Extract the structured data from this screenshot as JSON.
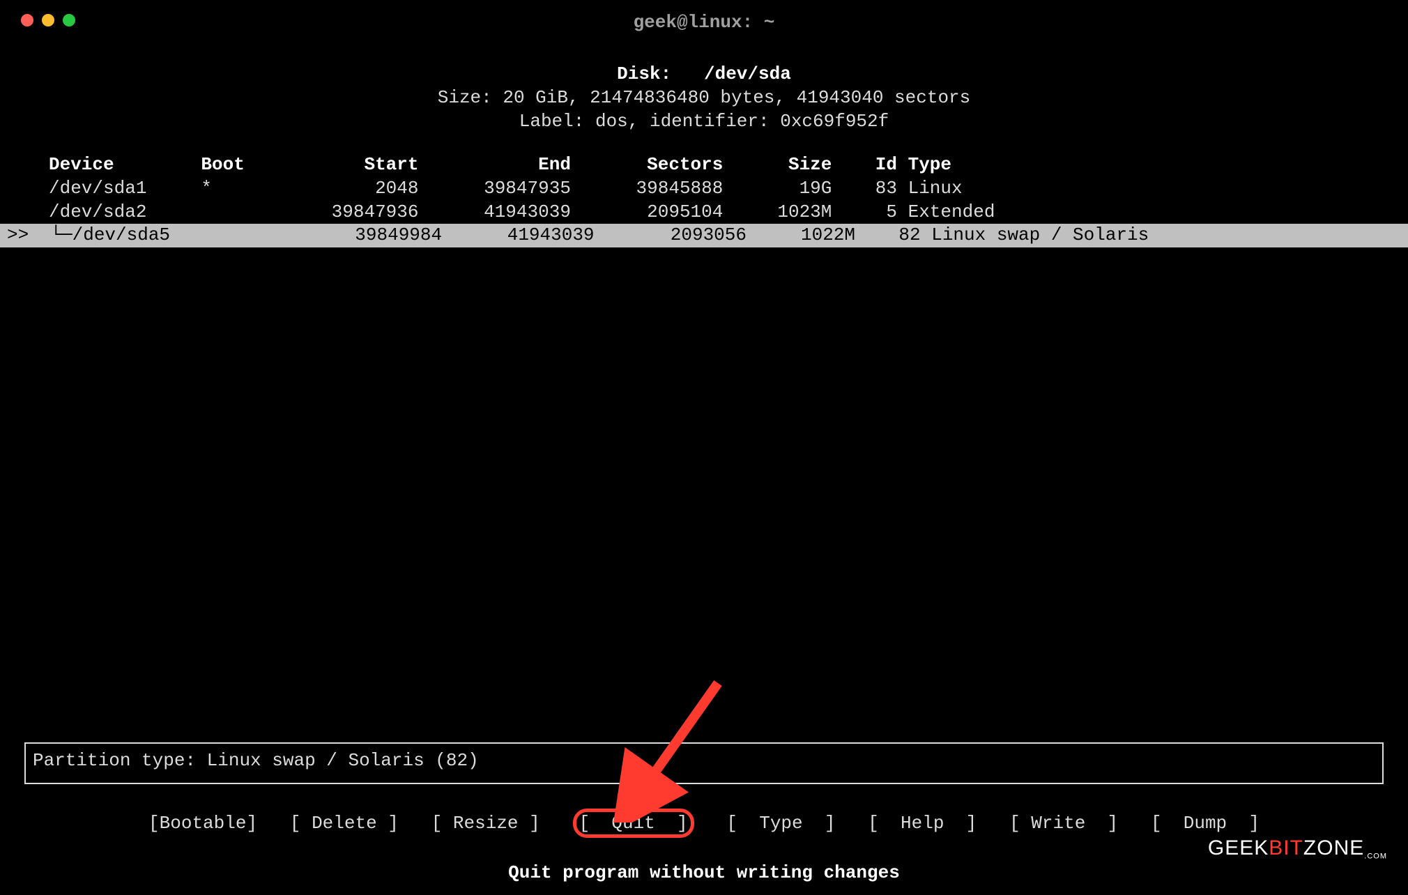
{
  "window": {
    "title": "geek@linux: ~"
  },
  "header": {
    "disk_label": "Disk:",
    "disk_path": "/dev/sda",
    "size_line": "Size: 20 GiB, 21474836480 bytes, 41943040 sectors",
    "label_line": "Label: dos, identifier: 0xc69f952f"
  },
  "table": {
    "columns": {
      "device": "Device",
      "boot": "Boot",
      "start": "Start",
      "end": "End",
      "sectors": "Sectors",
      "size": "Size",
      "id": "Id",
      "type": "Type"
    },
    "rows": [
      {
        "selected": false,
        "prefix": "",
        "device": "/dev/sda1",
        "boot": "*",
        "start": "2048",
        "end": "39847935",
        "sectors": "39845888",
        "size": "19G",
        "id": "83",
        "type": "Linux"
      },
      {
        "selected": false,
        "prefix": "",
        "device": "/dev/sda2",
        "boot": "",
        "start": "39847936",
        "end": "41943039",
        "sectors": "2095104",
        "size": "1023M",
        "id": "5",
        "type": "Extended"
      },
      {
        "selected": true,
        "prefix": ">>  └─",
        "device": "/dev/sda5",
        "boot": "",
        "start": "39849984",
        "end": "41943039",
        "sectors": "2093056",
        "size": "1022M",
        "id": "82",
        "type": "Linux swap / Solaris"
      }
    ]
  },
  "partition_info": "Partition type: Linux swap / Solaris (82)",
  "menu": {
    "items": [
      {
        "label": "Bootable",
        "highlighted": false
      },
      {
        "label": "Delete",
        "highlighted": false
      },
      {
        "label": "Resize",
        "highlighted": false
      },
      {
        "label": "Quit",
        "highlighted": true
      },
      {
        "label": "Type",
        "highlighted": false
      },
      {
        "label": "Help",
        "highlighted": false
      },
      {
        "label": "Write",
        "highlighted": false
      },
      {
        "label": "Dump",
        "highlighted": false
      }
    ]
  },
  "hint": "Quit program without writing changes",
  "watermark": {
    "a": "GEEK",
    "b": "BIT",
    "c": "ZONE",
    "d": ".COM"
  },
  "annotation": {
    "arrow_target": "menu-item-quit"
  }
}
